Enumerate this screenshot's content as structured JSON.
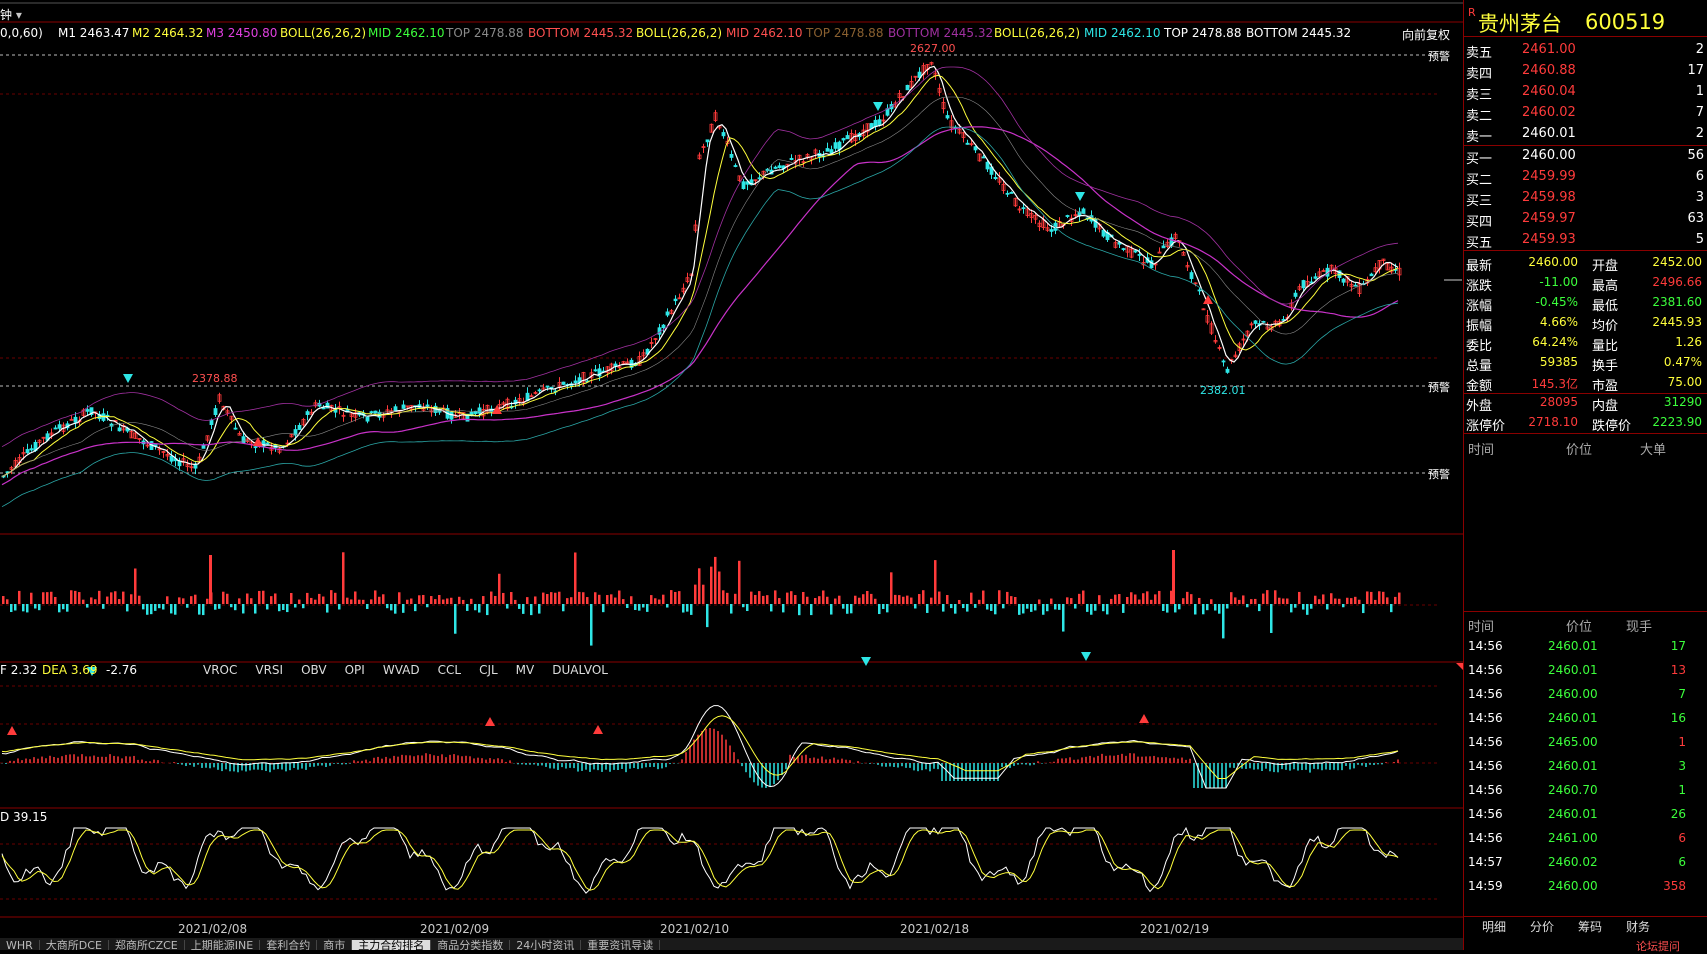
{
  "colors": {
    "up": "#ff3b3b",
    "down": "#2ee6e6",
    "grid": "#8a0000",
    "yellow": "#ffff3c",
    "green": "#3cff3c",
    "magenta": "#c832c8",
    "white": "#ffffff",
    "orange": "#e8b04a"
  },
  "top_indicators": {
    "period": "钟",
    "ma_params": "0,0,60)",
    "m1": "M1 2463.47",
    "m2": "M2 2464.32",
    "m3": "M3 2450.80",
    "boll1": "BOLL(26,26,2)",
    "mid1": "MID 2462.10",
    "top1": "TOP 2478.88",
    "bottom1": "BOTTOM 2445.32",
    "boll2": "BOLL(26,26,2)",
    "mid2": "MID 2462.10",
    "top2": "TOP 2478.88",
    "bottom2": "BOTTOM 2445.32",
    "boll3": "BOLL(26,26,2)",
    "mid3": "MID 2462.10",
    "top3": "TOP 2478.88",
    "bottom3": "BOTTOM 2445.32",
    "restore": "向前复权"
  },
  "price_marks": {
    "high": "2627.00",
    "low": "2382.01",
    "left_high": "2378.88",
    "alert": "预警"
  },
  "macd_bar": {
    "dif": "F 2.32",
    "dea": "DEA 3.69",
    "macd": "-2.76",
    "tabs": [
      "VROC",
      "VRSI",
      "OBV",
      "OPI",
      "WVAD",
      "CCL",
      "CJL",
      "MV",
      "DUALVOL"
    ]
  },
  "kd_label": "D 39.15",
  "dates": [
    "2021/02/08",
    "2021/02/09",
    "2021/02/10",
    "2021/02/18",
    "2021/02/19"
  ],
  "bottom_tabs": [
    "WHR",
    "大商所DCE",
    "郑商所CZCE",
    "上期能源INE",
    "套利合约",
    "商市",
    "主力合约排名",
    "商品分类指数",
    "24小时资讯",
    "重要资讯导读"
  ],
  "stock": {
    "flag": "R",
    "name": "贵州茅台",
    "code": "600519"
  },
  "asks": [
    {
      "label": "卖五",
      "price": "2461.00",
      "vol": "2"
    },
    {
      "label": "卖四",
      "price": "2460.88",
      "vol": "17"
    },
    {
      "label": "卖三",
      "price": "2460.04",
      "vol": "1"
    },
    {
      "label": "卖二",
      "price": "2460.02",
      "vol": "7"
    },
    {
      "label": "卖一",
      "price": "2460.01",
      "vol": "2"
    }
  ],
  "bids": [
    {
      "label": "买一",
      "price": "2460.00",
      "vol": "56"
    },
    {
      "label": "买二",
      "price": "2459.99",
      "vol": "6"
    },
    {
      "label": "买三",
      "price": "2459.98",
      "vol": "3"
    },
    {
      "label": "买四",
      "price": "2459.97",
      "vol": "63"
    },
    {
      "label": "买五",
      "price": "2459.93",
      "vol": "5"
    }
  ],
  "stats": [
    {
      "l1": "最新",
      "v1": "2460.00",
      "l2": "开盘",
      "v2": "2452.00"
    },
    {
      "l1": "涨跌",
      "v1": "-11.00",
      "l2": "最高",
      "v2": "2496.66"
    },
    {
      "l1": "涨幅",
      "v1": "-0.45%",
      "l2": "最低",
      "v2": "2381.60"
    },
    {
      "l1": "振幅",
      "v1": "4.66%",
      "l2": "均价",
      "v2": "2445.93"
    },
    {
      "l1": "委比",
      "v1": "64.24%",
      "l2": "量比",
      "v2": "1.26"
    },
    {
      "l1": "总量",
      "v1": "59385",
      "l2": "换手",
      "v2": "0.47%"
    },
    {
      "l1": "金额",
      "v1": "145.3亿",
      "l2": "市盈",
      "v2": "75.00"
    },
    {
      "l1": "外盘",
      "v1": "28095",
      "l2": "内盘",
      "v2": "31290"
    },
    {
      "l1": "涨停价",
      "v1": "2718.10",
      "l2": "跌停价",
      "v2": "2223.90"
    }
  ],
  "big_header": {
    "time": "时间",
    "price": "价位",
    "big": "大单"
  },
  "tick_header": {
    "time": "时间",
    "price": "价位",
    "vol": "现手"
  },
  "ticks": [
    {
      "time": "14:56",
      "price": "2460.01",
      "vol": "17"
    },
    {
      "time": "14:56",
      "price": "2460.01",
      "vol": "13"
    },
    {
      "time": "14:56",
      "price": "2460.00",
      "vol": "7"
    },
    {
      "time": "14:56",
      "price": "2460.01",
      "vol": "16"
    },
    {
      "time": "14:56",
      "price": "2465.00",
      "vol": "1"
    },
    {
      "time": "14:56",
      "price": "2460.01",
      "vol": "3"
    },
    {
      "time": "14:56",
      "price": "2460.70",
      "vol": "1"
    },
    {
      "time": "14:56",
      "price": "2460.01",
      "vol": "26"
    },
    {
      "time": "14:56",
      "price": "2461.00",
      "vol": "6"
    },
    {
      "time": "14:57",
      "price": "2460.02",
      "vol": "6"
    },
    {
      "time": "14:59",
      "price": "2460.00",
      "vol": "358"
    }
  ],
  "right_tabs": [
    "明细",
    "分价",
    "筹码",
    "财务"
  ],
  "footer_link": "论坛提问"
}
